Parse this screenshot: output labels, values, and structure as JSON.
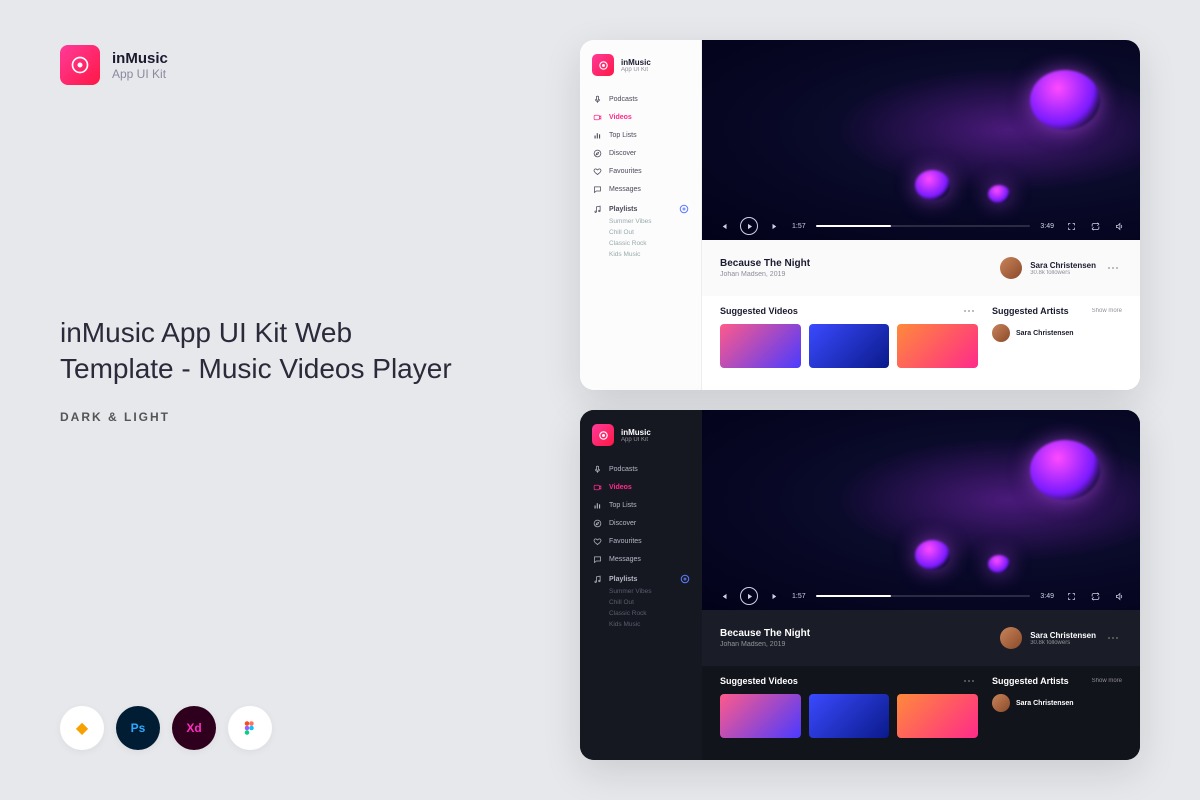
{
  "brand": {
    "name": "inMusic",
    "subtitle": "App UI Kit"
  },
  "promo": {
    "heading": "inMusic App UI Kit Web Template -  Music Videos Player",
    "sublabel": "DARK & LIGHT"
  },
  "tools": [
    "sketch",
    "ps",
    "xd",
    "figma"
  ],
  "sidebar": {
    "items": [
      {
        "label": "Podcasts",
        "icon": "mic"
      },
      {
        "label": "Videos",
        "icon": "video",
        "active": true
      },
      {
        "label": "Top Lists",
        "icon": "bars"
      },
      {
        "label": "Discover",
        "icon": "compass"
      },
      {
        "label": "Favourites",
        "icon": "heart"
      },
      {
        "label": "Messages",
        "icon": "chat"
      }
    ],
    "playlists_label": "Playlists",
    "playlists": [
      {
        "label": "Summer Vibes"
      },
      {
        "label": "Chill Out"
      },
      {
        "label": "Classic Rock"
      },
      {
        "label": "Kids Music"
      }
    ]
  },
  "player": {
    "current_time": "1:57",
    "total_time": "3:49"
  },
  "track": {
    "title": "Because The Night",
    "subtitle": "Johan Madsen, 2019"
  },
  "artist": {
    "name": "Sara Christensen",
    "followers": "30.8k followers"
  },
  "suggested": {
    "videos_label": "Suggested Videos",
    "artists_label": "Suggested Artists",
    "show_more": "Show more",
    "artist": {
      "name": "Sara Christensen"
    }
  },
  "colors": {
    "accent": "#ff2b8a",
    "dark_bg": "#161821",
    "light_bg": "#ffffff"
  }
}
